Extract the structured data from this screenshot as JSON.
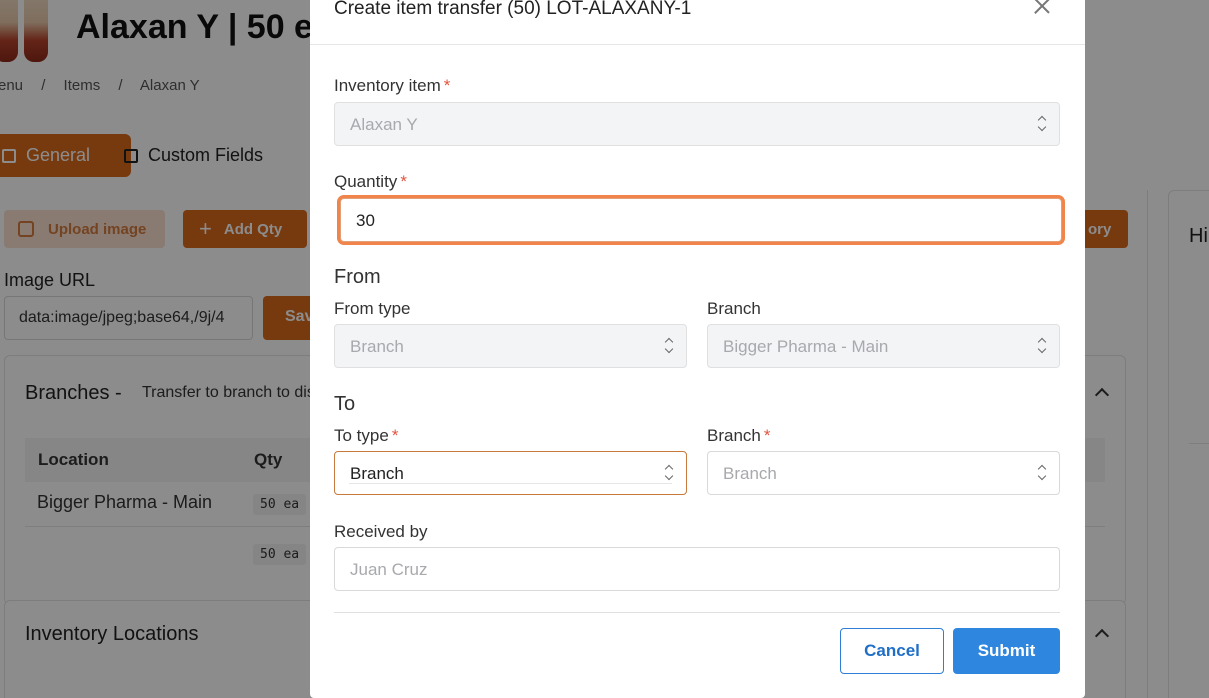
{
  "background": {
    "page_title": "Alaxan Y | 50 e",
    "breadcrumb": [
      "enu",
      "/",
      "Items",
      "/",
      "Alaxan Y"
    ],
    "tabs": [
      {
        "label": "General",
        "active": true
      },
      {
        "label": "Custom Fields",
        "active": false
      }
    ],
    "buttons": {
      "upload_image": "Upload image",
      "add_qty": "Add Qty",
      "history": "ory",
      "save": "Sav"
    },
    "image_url": {
      "label": "Image URL",
      "value": "data:image/jpeg;base64,/9j/4"
    },
    "branches_card": {
      "title": "Branches -",
      "subtitle": "Transfer to branch to dis",
      "columns": [
        "Location",
        "Qty"
      ],
      "rows": [
        {
          "location": "Bigger Pharma - Main",
          "qty": "50 ea"
        },
        {
          "location": "",
          "qty": "50 ea"
        }
      ]
    },
    "inventory_locations": {
      "title": "Inventory Locations"
    },
    "side_card": {
      "title": "Hi"
    },
    "accent_color": "#d96a1c"
  },
  "modal": {
    "title": "Create item transfer (50) LOT-ALAXANY-1",
    "inventory_item": {
      "label": "Inventory item",
      "required": "*",
      "value": "Alaxan Y"
    },
    "quantity": {
      "label": "Quantity",
      "required": "*",
      "value": "30"
    },
    "from": {
      "section": "From",
      "type_label": "From type",
      "type_value": "Branch",
      "branch_label": "Branch",
      "branch_value": "Bigger Pharma - Main"
    },
    "to": {
      "section": "To",
      "type_label": "To type",
      "type_required": "*",
      "type_value": "Branch",
      "branch_label": "Branch",
      "branch_required": "*",
      "branch_placeholder": "Branch"
    },
    "received_by": {
      "label": "Received by",
      "placeholder": "Juan Cruz"
    },
    "buttons": {
      "cancel": "Cancel",
      "submit": "Submit"
    },
    "colors": {
      "primary": "#2e86de",
      "focus_ring": "#f0844b",
      "required": "#e2543e"
    }
  }
}
